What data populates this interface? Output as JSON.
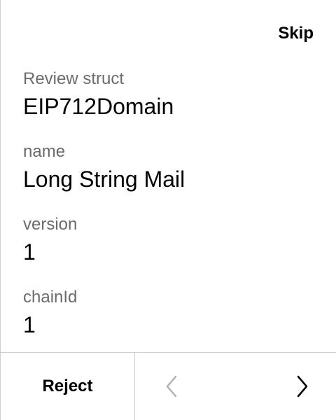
{
  "header": {
    "skip_label": "Skip"
  },
  "fields": [
    {
      "label": "Review struct",
      "value": "EIP712Domain"
    },
    {
      "label": "name",
      "value": "Long String Mail"
    },
    {
      "label": "version",
      "value": "1"
    },
    {
      "label": "chainId",
      "value": "1"
    }
  ],
  "footer": {
    "reject_label": "Reject",
    "prev_icon": "chevron-left-icon",
    "next_icon": "chevron-right-icon",
    "prev_enabled": false,
    "next_enabled": true
  },
  "colors": {
    "label": "#6b6b6b",
    "value": "#000000",
    "divider": "#cfcfcf",
    "disabled_icon": "#b5b5b5"
  }
}
